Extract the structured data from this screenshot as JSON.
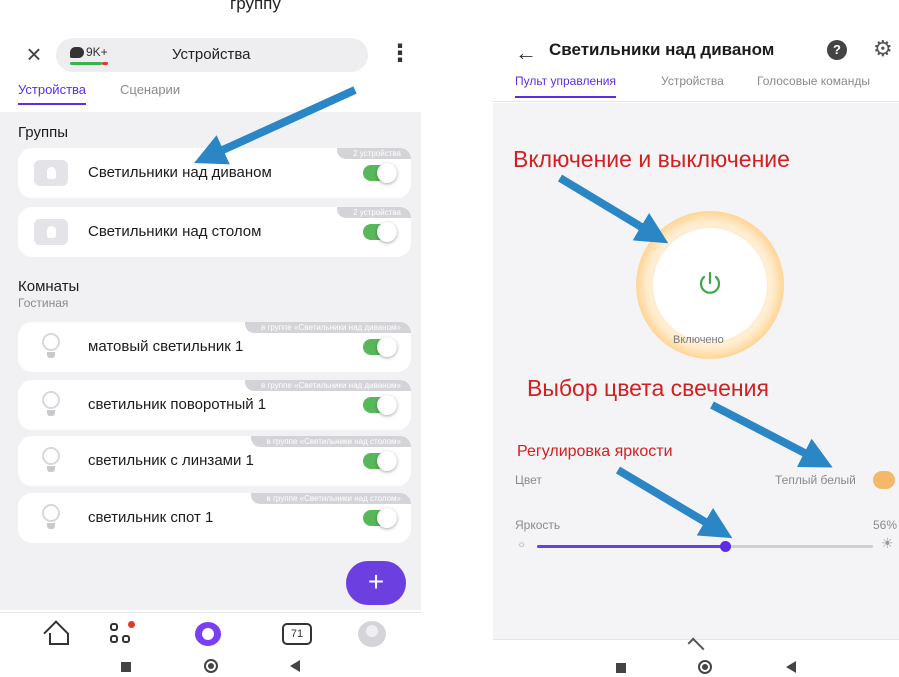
{
  "caption": "группу",
  "left": {
    "header": {
      "badge_count": "9K+",
      "title": "Устройства"
    },
    "tabs": [
      {
        "label": "Устройства",
        "active": true
      },
      {
        "label": "Сценарии",
        "active": false
      }
    ],
    "groups_title": "Группы",
    "groups": [
      {
        "name": "Светильники над диваном",
        "tag": "2 устройства",
        "on": true
      },
      {
        "name": "Светильники над столом",
        "tag": "2 устройства",
        "on": true
      }
    ],
    "rooms_title": "Комнаты",
    "room_name": "Гостиная",
    "devices": [
      {
        "name": "матовый светильник 1",
        "tag": "в группе «Светильники над диваном»",
        "on": true
      },
      {
        "name": "светильник поворотный 1",
        "tag": "в группе «Светильники над диваном»",
        "on": true
      },
      {
        "name": "светильник с линзами 1",
        "tag": "в группе «Светильники над столом»",
        "on": true
      },
      {
        "name": "светильник спот 1",
        "tag": "в группе «Светильники над столом»",
        "on": true
      }
    ],
    "fab_label": "+",
    "nav": {
      "calendar_day": "71"
    }
  },
  "right": {
    "title": "Светильники над диваном",
    "help_glyph": "?",
    "tabs": [
      {
        "label": "Пульт управления",
        "active": true
      },
      {
        "label": "Устройства",
        "active": false
      },
      {
        "label": "Голосовые команды",
        "active": false
      }
    ],
    "power_status": "Включено",
    "color_label": "Цвет",
    "color_value": "Теплый белый",
    "color_swatch": "#f5b76a",
    "brightness_label": "Яркость",
    "brightness_value": "56%",
    "brightness_fraction": 0.56
  },
  "annotations": {
    "power": "Включение и выключение",
    "color": "Выбор цвета свечения",
    "brightness": "Регулировка яркости"
  },
  "colors": {
    "accent": "#5b2ee6",
    "toggle_on": "#57b85a",
    "annotation": "#d0201f",
    "arrow": "#2a86c4"
  },
  "icons": [
    "close-icon",
    "chat-bubble-icon",
    "kebab-menu-icon",
    "group-lamp-icon",
    "bulb-icon",
    "home-icon",
    "devices-grid-icon",
    "alice-icon",
    "calendar-icon",
    "avatar-icon",
    "back-arrow-icon",
    "help-icon",
    "gear-icon",
    "power-icon",
    "sun-min-icon",
    "sun-max-icon",
    "chevron-up-icon"
  ]
}
